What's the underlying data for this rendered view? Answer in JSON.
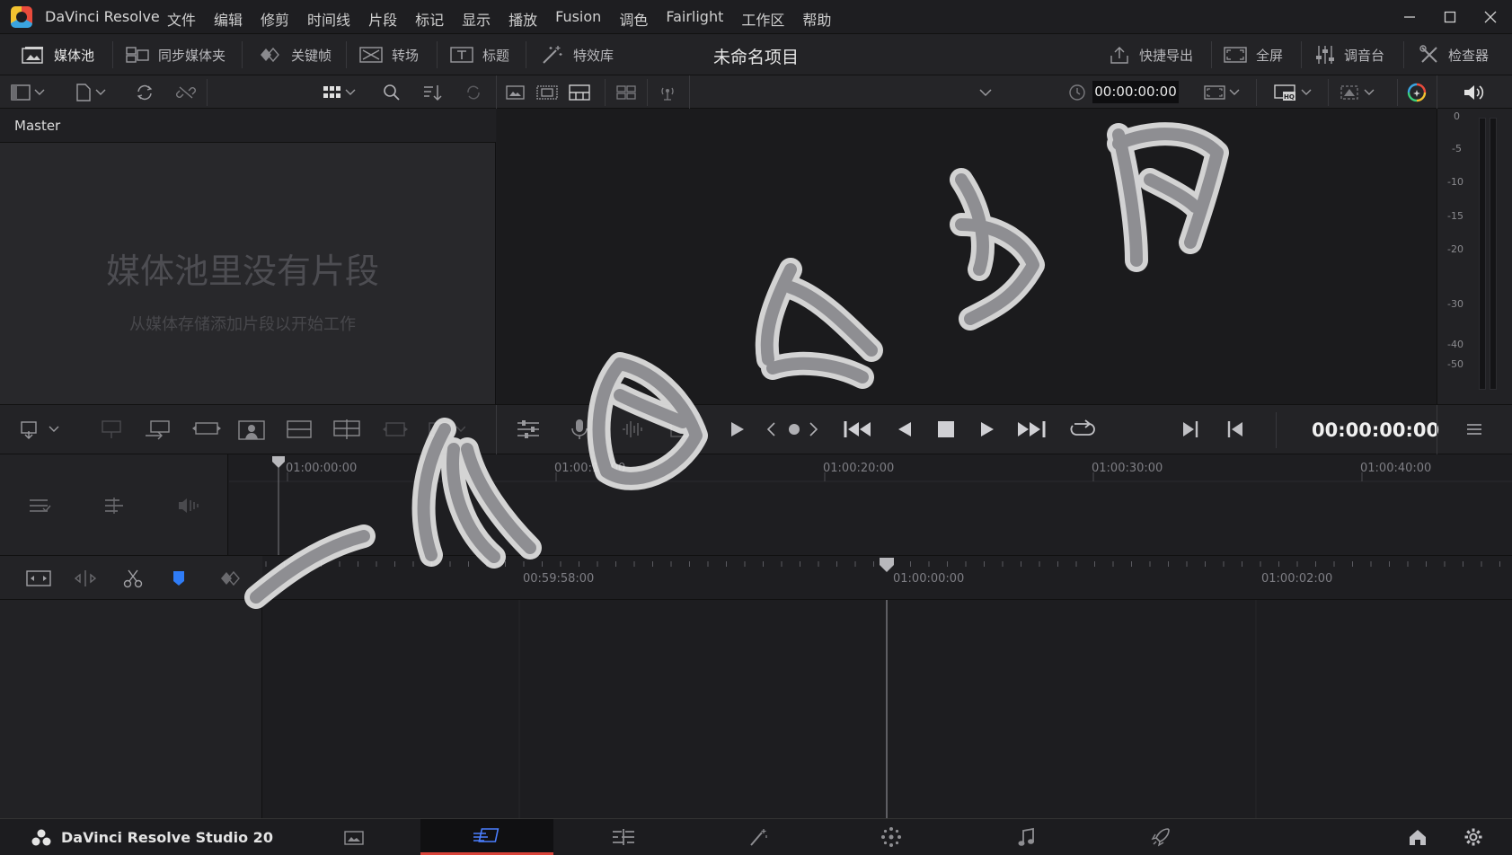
{
  "app": {
    "name": "DaVinci Resolve",
    "brand": "DaVinci Resolve Studio 20",
    "project_title": "未命名项目"
  },
  "menu": [
    "文件",
    "编辑",
    "修剪",
    "时间线",
    "片段",
    "标记",
    "显示",
    "播放",
    "Fusion",
    "调色",
    "Fairlight",
    "工作区",
    "帮助"
  ],
  "toolbar": {
    "media_pool": "媒体池",
    "sync_bin": "同步媒体夹",
    "keyframes": "关键帧",
    "transitions": "转场",
    "titles": "标题",
    "effects": "特效库",
    "quick_export": "快捷导出",
    "fullscreen": "全屏",
    "mixer": "调音台",
    "inspector": "检查器"
  },
  "viewer": {
    "timecode": "00:00:00:00"
  },
  "mediapool": {
    "bin": "Master",
    "empty_title": "媒体池里没有片段",
    "empty_sub": "从媒体存储添加片段以开始工作"
  },
  "meters": {
    "labels": [
      "0",
      "-5",
      "-10",
      "-15",
      "-20",
      "-30",
      "-40",
      "-50"
    ]
  },
  "transport": {
    "timecode": "00:00:00:00"
  },
  "upper_ruler": [
    "01:00:00:00",
    "01:00:10:00",
    "01:00:20:00",
    "01:00:30:00",
    "01:00:40:00"
  ],
  "lower_ruler": [
    "00:59:58:00",
    "01:00:00:00",
    "01:00:02:00"
  ],
  "watermark": "一个自学者网"
}
